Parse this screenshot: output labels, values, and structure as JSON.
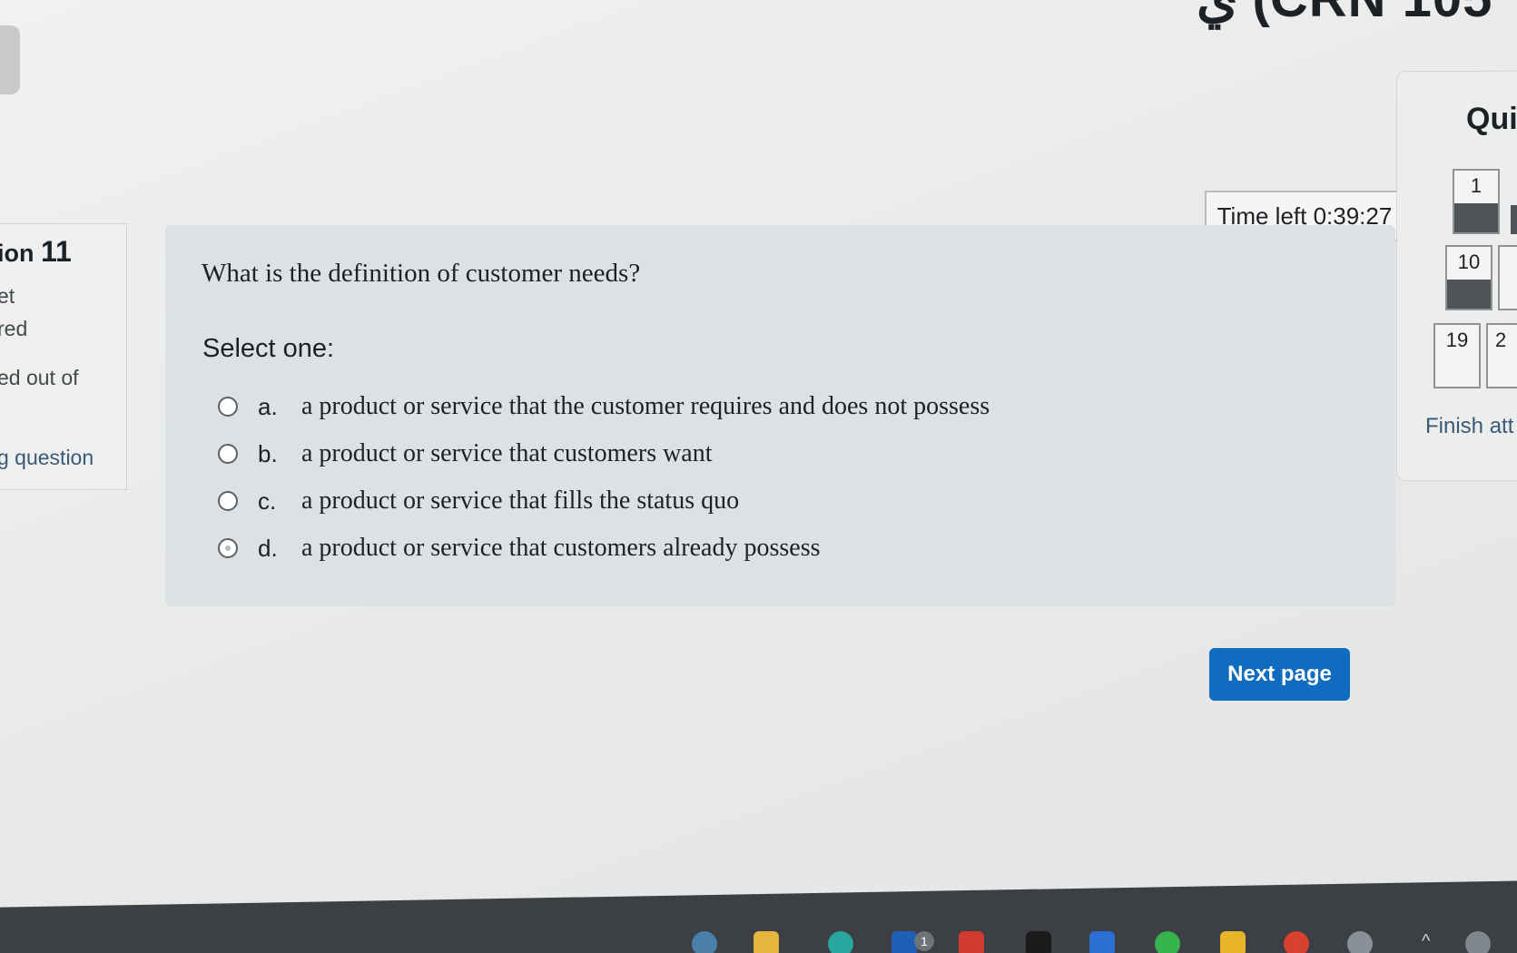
{
  "header": {
    "title_fragment": "ي (CRN 105"
  },
  "info": {
    "question_label": "ion",
    "question_number": "11",
    "status": "et",
    "status2": "red",
    "marks": "ed out of",
    "flag_label": "g question"
  },
  "timer": {
    "text": "Time left 0:39:27"
  },
  "question": {
    "text": "What is the definition of customer needs?",
    "prompt": "Select one:",
    "answers": [
      {
        "letter": "a.",
        "text": "a product or service that the customer requires and does not possess"
      },
      {
        "letter": "b.",
        "text": "a product or service that customers want"
      },
      {
        "letter": "c.",
        "text": "a product or service that fills the status quo"
      },
      {
        "letter": "d.",
        "text": "a product or service that customers already possess"
      }
    ]
  },
  "next_button": {
    "label": "Next page"
  },
  "quiz_nav": {
    "title": "Qui",
    "buttons": [
      "1",
      "10",
      "19",
      "2"
    ],
    "finish_label": "Finish att"
  },
  "taskbar": {
    "badge_count": "1"
  },
  "colors": {
    "primary_button": "#0f6cbf",
    "card_background": "#dce2e3",
    "answered_fill": "#505458",
    "link": "#3a5a75"
  }
}
